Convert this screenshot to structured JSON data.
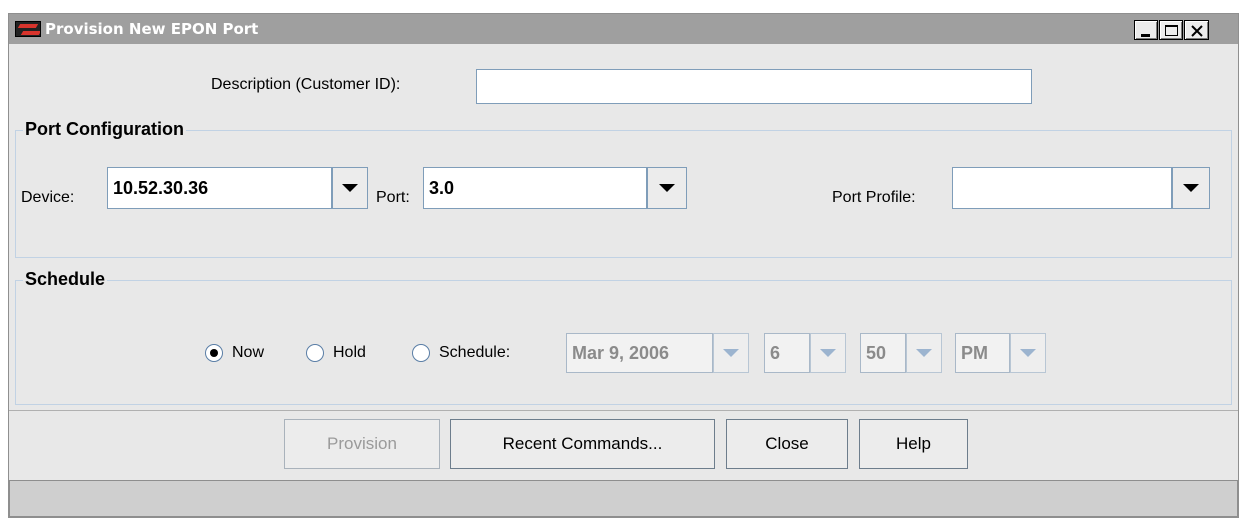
{
  "window": {
    "title": "Provision New EPON Port",
    "icon": "app-logo-icon",
    "controls": [
      "minimize-icon",
      "maximize-icon",
      "close-icon"
    ]
  },
  "description": {
    "label": "Description (Customer ID):",
    "value": ""
  },
  "port_configuration": {
    "title": "Port Configuration",
    "device_label": "Device:",
    "device_value": "10.52.30.36",
    "port_label": "Port:",
    "port_value": "3.0",
    "profile_label": "Port Profile:",
    "profile_value": ""
  },
  "schedule": {
    "title": "Schedule",
    "options": [
      "Now",
      "Hold",
      "Schedule:"
    ],
    "selected": "Now",
    "date": "Mar 9, 2006",
    "hour": "6",
    "minute": "50",
    "ampm": "PM"
  },
  "buttons": {
    "provision": "Provision",
    "recent": "Recent Commands...",
    "close": "Close",
    "help": "Help"
  },
  "colors": {
    "titlebar": "#9f9f9f",
    "window_bg": "#e8e8e8",
    "field_border": "#7f9db9",
    "group_border": "#c1d2e4"
  }
}
